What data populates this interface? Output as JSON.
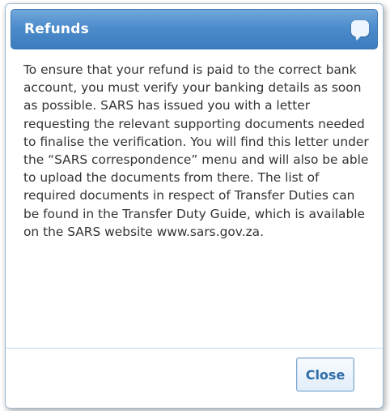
{
  "dialog": {
    "title": "Refunds",
    "message": "To ensure that your refund is paid to the correct bank account, you must verify your banking details as soon as possible. SARS has issued you with a letter requesting the relevant supporting documents needed to finalise the verification. You will find this letter under the “SARS correspondence” menu and will also be able to upload the documents from there. The list of required documents in respect of Transfer Duties can be found in the Transfer Duty Guide, which is available on the SARS website www.sars.gov.za.",
    "close_label": "Close",
    "title_icon": "chat-bubble-icon"
  },
  "colors": {
    "title_bar": "#4d8ccb",
    "title_text": "#ffffff",
    "body_text": "#333333",
    "button_text": "#2e6da8",
    "border": "#9cbcd9"
  }
}
